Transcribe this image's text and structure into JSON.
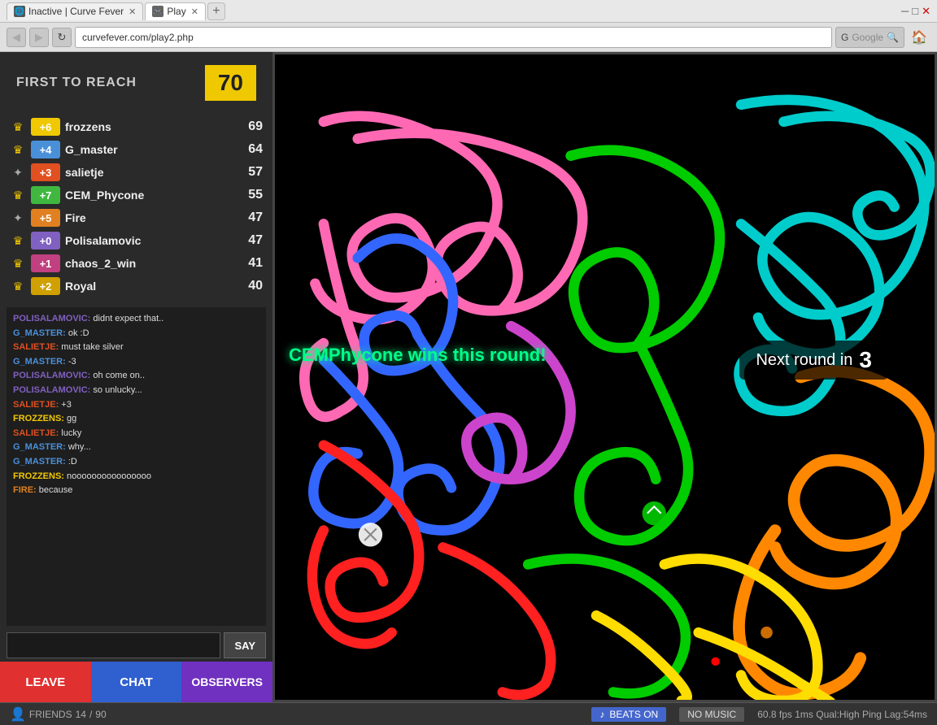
{
  "browser": {
    "tabs": [
      {
        "label": "Inactive | Curve Fever",
        "active": false,
        "icon": "🌐"
      },
      {
        "label": "Play",
        "active": true,
        "icon": "🎮"
      }
    ],
    "address": "curvefever.com/play2.php",
    "search_placeholder": "Google"
  },
  "sidebar": {
    "first_to_reach_label": "FIRST TO REACH",
    "target_score": "70",
    "players": [
      {
        "icon": "crown",
        "badge": "+6",
        "badge_color": "#f0c800",
        "name": "frozzens",
        "score": "69"
      },
      {
        "icon": "crown",
        "badge": "+4",
        "badge_color": "#4a90d9",
        "name": "G_master",
        "score": "64"
      },
      {
        "icon": "wing",
        "badge": "+3",
        "badge_color": "#e05020",
        "name": "salietje",
        "score": "57"
      },
      {
        "icon": "crown",
        "badge": "+7",
        "badge_color": "#40b840",
        "name": "CEM_Phycone",
        "score": "55"
      },
      {
        "icon": "wing",
        "badge": "+5",
        "badge_color": "#e08020",
        "name": "Fire",
        "score": "47"
      },
      {
        "icon": "crown",
        "badge": "+0",
        "badge_color": "#8060c0",
        "name": "Polisalamovic",
        "score": "47"
      },
      {
        "icon": "crown",
        "badge": "+1",
        "badge_color": "#c04080",
        "name": "chaos_2_win",
        "score": "41"
      },
      {
        "icon": "crown",
        "badge": "+2",
        "badge_color": "#d0a000",
        "name": "Royal",
        "score": "40"
      }
    ],
    "chat": [
      {
        "username": "POLISALAMOVIC",
        "username_color": "#8060c0",
        "text": " didnt expect that.."
      },
      {
        "username": "G_MASTER",
        "username_color": "#4a90d9",
        "text": " ok :D"
      },
      {
        "username": "SALIETJE",
        "username_color": "#e05020",
        "text": " must take silver"
      },
      {
        "username": "G_MASTER",
        "username_color": "#4a90d9",
        "text": " -3"
      },
      {
        "username": "POLISALAMOVIC",
        "username_color": "#8060c0",
        "text": " oh come on.."
      },
      {
        "username": "POLISALAMOVIC",
        "username_color": "#8060c0",
        "text": " so unlucky..."
      },
      {
        "username": "SALIETJE",
        "username_color": "#e05020",
        "text": " +3"
      },
      {
        "username": "FROZZENS",
        "username_color": "#f0c800",
        "text": " gg"
      },
      {
        "username": "SALIETJE",
        "username_color": "#e05020",
        "text": " lucky"
      },
      {
        "username": "G_MASTER",
        "username_color": "#4a90d9",
        "text": " why..."
      },
      {
        "username": "G_MASTER",
        "username_color": "#4a90d9",
        "text": " :D"
      },
      {
        "username": "FROZZENS",
        "username_color": "#f0c800",
        "text": " noooooooooooooooo"
      },
      {
        "username": "FIRE",
        "username_color": "#e08020",
        "text": " because"
      }
    ],
    "say_label": "SAY",
    "leave_label": "LEAVE",
    "chat_label": "CHAT",
    "observers_label": "OBSERVERS"
  },
  "game": {
    "win_message": "CEMPhycone wins this round!",
    "next_round_label": "Next round in",
    "next_round_count": "3"
  },
  "statusbar": {
    "friends_label": "FRIENDS",
    "friends_count": "14",
    "friends_max": "90",
    "beats_label": "BEATS ON",
    "music_label": "NO MUSIC",
    "stats": "60.8 fps 1ms Qual:High Ping Lag:54ms"
  }
}
